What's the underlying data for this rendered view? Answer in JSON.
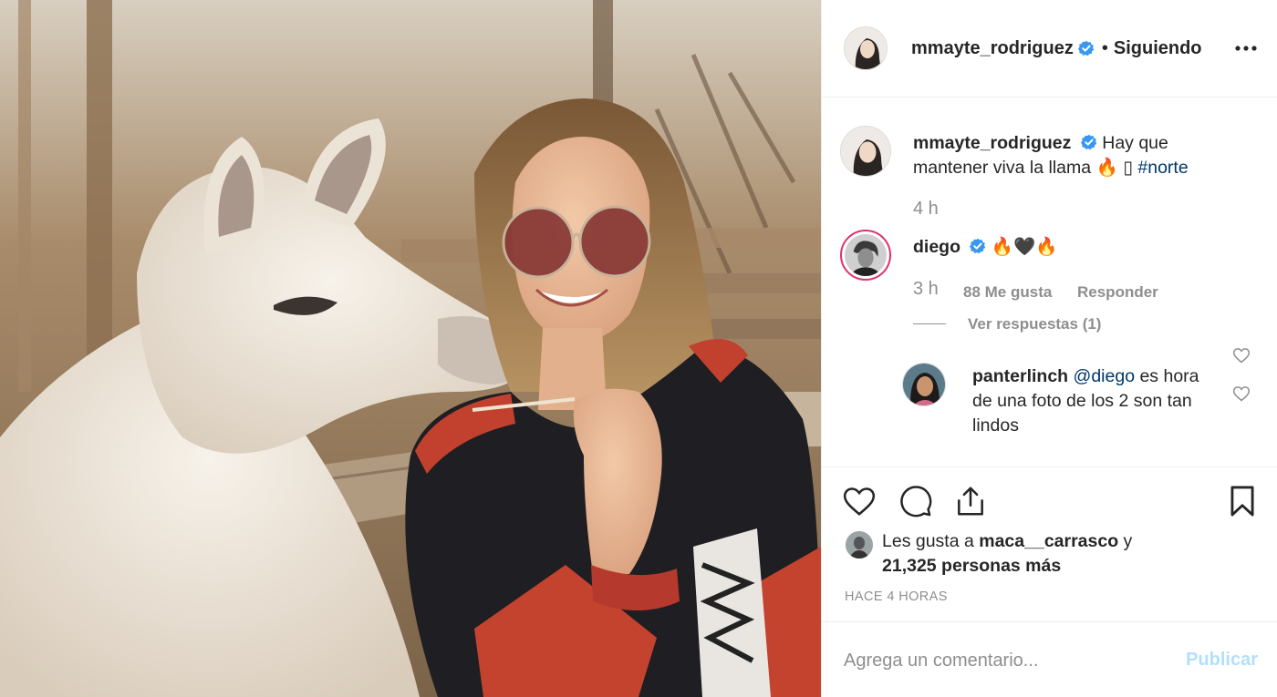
{
  "post": {
    "author": "mmayte_rodriguez",
    "follow_status": "Siguiendo",
    "separator": "•",
    "photo_alt": "Foto de mmayte_rodriguez",
    "caption": {
      "username": "mmayte_rodriguez",
      "text": "Hay que mantener viva la llama ",
      "emoji": "🔥 ▯",
      "hashtag": "#norte",
      "time": "4 h"
    },
    "comments": [
      {
        "username": "diego",
        "text": "🔥🖤🔥",
        "time": "3 h",
        "likes": "88 Me gusta",
        "reply_label": "Responder",
        "view_replies": "Ver respuestas (1)"
      },
      {
        "username": "panterlinch",
        "mention": "@diego",
        "text": " es hora de una foto de los 2 son tan lindos"
      }
    ],
    "likes": {
      "prefix": "Les gusta a ",
      "user": "maca__carrasco",
      "connector": " y",
      "count": "21,325 personas más"
    },
    "time_ago": "HACE 4 HORAS",
    "composer": {
      "placeholder": "Agrega un comentario...",
      "publish_label": "Publicar"
    }
  },
  "icons": {
    "more": "more-options-icon",
    "verified": "verified-badge-icon",
    "like": "heart-icon",
    "comment": "comment-icon",
    "share": "share-icon",
    "save": "bookmark-icon"
  },
  "colors": {
    "verified": "#3897f0",
    "link": "#00376b",
    "muted": "#8e8e8e",
    "publish_disabled": "#b2dffc",
    "story_ring_start": "#f09433",
    "story_ring_end": "#bc1888"
  }
}
